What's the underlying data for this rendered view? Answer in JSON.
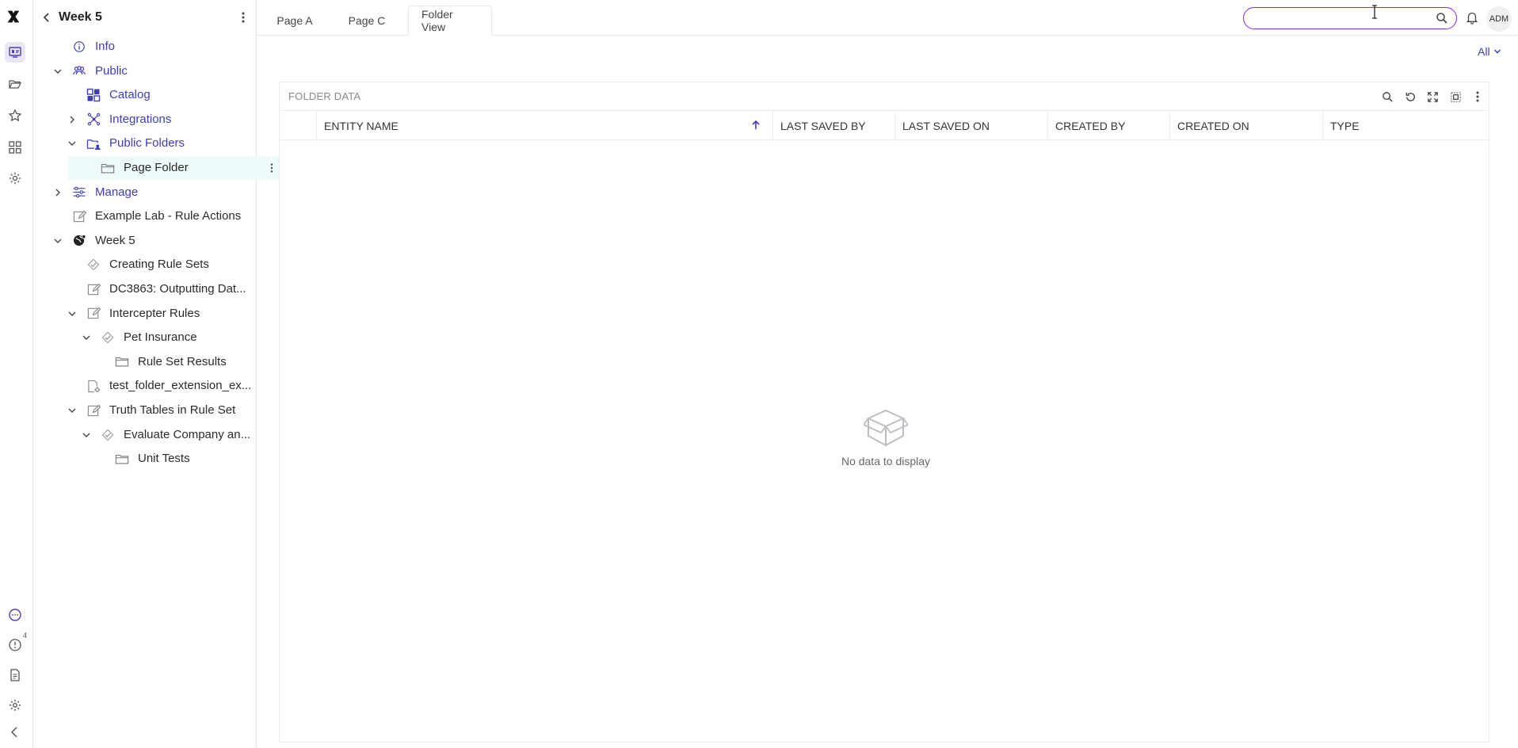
{
  "sidebar": {
    "title": "Week 5",
    "tree": [
      {
        "label": "Info",
        "depth": 0,
        "style": "blue",
        "chevron": "none",
        "icon": "info-icon"
      },
      {
        "label": "Public",
        "depth": 0,
        "style": "blue",
        "chevron": "down",
        "icon": "users-icon"
      },
      {
        "label": "Catalog",
        "depth": 1,
        "style": "blue",
        "chevron": "none",
        "icon": "catalog-icon"
      },
      {
        "label": "Integrations",
        "depth": 1,
        "style": "blue",
        "chevron": "right",
        "icon": "integrations-icon"
      },
      {
        "label": "Public Folders",
        "depth": 1,
        "style": "blue",
        "chevron": "down",
        "icon": "public-folders-icon"
      },
      {
        "label": "Page Folder",
        "depth": 2,
        "style": "dark",
        "chevron": "none",
        "icon": "folder-icon",
        "selected": true
      },
      {
        "label": "Manage",
        "depth": 0,
        "style": "blue",
        "chevron": "right",
        "icon": "sliders-icon"
      },
      {
        "label": "Example Lab - Rule Actions",
        "depth": 0,
        "style": "dark",
        "chevron": "none",
        "icon": "edit-icon"
      },
      {
        "label": "Week 5",
        "depth": 0,
        "style": "dark",
        "chevron": "down",
        "icon": "globe-icon"
      },
      {
        "label": "Creating Rule Sets",
        "depth": 1,
        "style": "dark",
        "chevron": "none",
        "icon": "ruleset-icon"
      },
      {
        "label": "DC3863: Outputting Dat...",
        "depth": 1,
        "style": "dark",
        "chevron": "none",
        "icon": "edit-icon"
      },
      {
        "label": "Intercepter Rules",
        "depth": 1,
        "style": "dark",
        "chevron": "down",
        "icon": "edit-icon"
      },
      {
        "label": "Pet Insurance",
        "depth": 2,
        "style": "dark",
        "chevron": "down",
        "icon": "ruleset-icon"
      },
      {
        "label": "Rule Set Results",
        "depth": 3,
        "style": "dark",
        "chevron": "none",
        "icon": "folder-icon"
      },
      {
        "label": "test_folder_extension_ex...",
        "depth": 1,
        "style": "dark",
        "chevron": "none",
        "icon": "file-gear-icon"
      },
      {
        "label": "Truth Tables in Rule Set",
        "depth": 1,
        "style": "dark",
        "chevron": "down",
        "icon": "edit-icon"
      },
      {
        "label": "Evaluate Company an...",
        "depth": 2,
        "style": "dark",
        "chevron": "down",
        "icon": "ruleset-icon"
      },
      {
        "label": "Unit Tests",
        "depth": 3,
        "style": "dark",
        "chevron": "none",
        "icon": "folder-icon"
      }
    ]
  },
  "tabs": [
    {
      "label": "Page A",
      "active": false
    },
    {
      "label": "Page C",
      "active": false
    },
    {
      "label": "Folder View",
      "active": true
    }
  ],
  "search": {
    "value": "",
    "placeholder": ""
  },
  "user": {
    "initials": "ADM"
  },
  "rail": {
    "notification_count": "4"
  },
  "filter": {
    "label": "All"
  },
  "panel": {
    "title": "FOLDER DATA",
    "columns": [
      "ENTITY NAME",
      "LAST SAVED BY",
      "LAST SAVED ON",
      "CREATED BY",
      "CREATED ON",
      "TYPE"
    ],
    "rows": [],
    "empty_text": "No data to display"
  },
  "colors": {
    "accent": "#3d3db8",
    "search_border": "#8a2be2",
    "selected_row": "#eef9f9"
  }
}
